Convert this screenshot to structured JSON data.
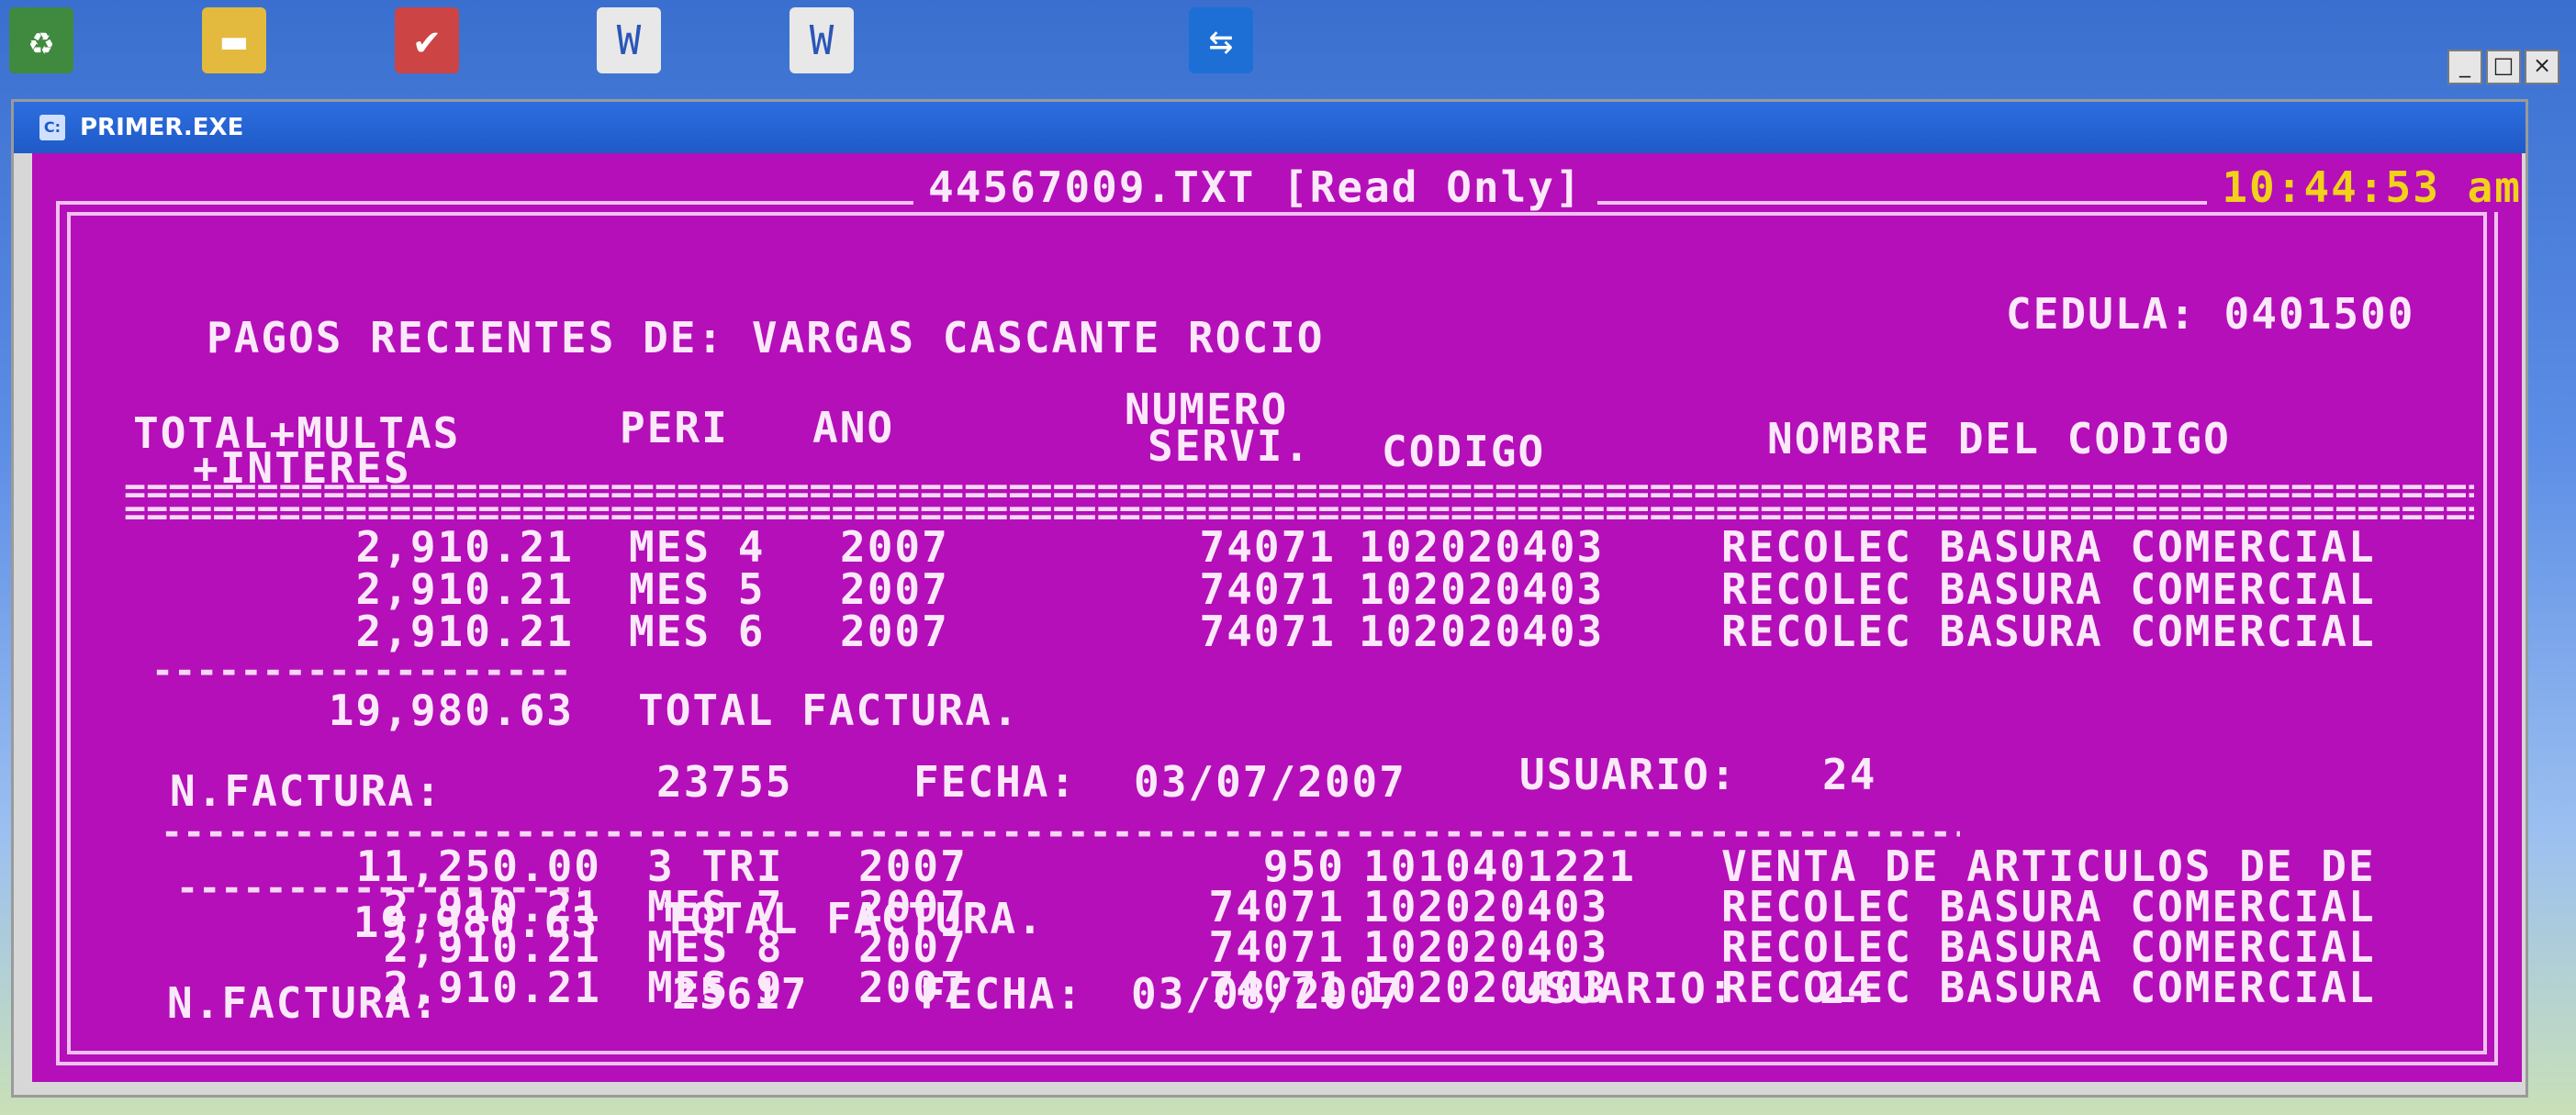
{
  "window": {
    "title": "PRIMER.EXE",
    "minimize": "_",
    "maximize": "□",
    "close": "×"
  },
  "screen": {
    "file_title": "44567009.TXT [Read Only]",
    "clock": "10:44:53 am",
    "heading": "PAGOS RECIENTES DE: VARGAS CASCANTE ROCIO",
    "cedula": "CEDULA: 0401500",
    "columns": {
      "total_line1": "TOTAL+MULTAS",
      "total_line2": "+INTERES",
      "peri": "PERI",
      "ano": "ANO",
      "numero_line1": "NUMERO",
      "numero_line2": "SERVI.",
      "codigo": "CODIGO",
      "nombre": "NOMBRE DEL CODIGO"
    },
    "invoices": [
      {
        "rows": [
          {
            "total": "2,910.21",
            "peri": "MES 4",
            "ano": "2007",
            "servi": "74071",
            "codigo": "102020403",
            "nombre": "RECOLEC BASURA COMERCIAL"
          },
          {
            "total": "2,910.21",
            "peri": "MES 5",
            "ano": "2007",
            "servi": "74071",
            "codigo": "102020403",
            "nombre": "RECOLEC BASURA COMERCIAL"
          },
          {
            "total": "2,910.21",
            "peri": "MES 6",
            "ano": "2007",
            "servi": "74071",
            "codigo": "102020403",
            "nombre": "RECOLEC BASURA COMERCIAL"
          }
        ],
        "total_amount": "19,980.63",
        "total_label": "TOTAL FACTURA.",
        "factura_label": "N.FACTURA:",
        "factura": "23755",
        "fecha_label": "FECHA:",
        "fecha": "03/07/2007",
        "usuario_label": "USUARIO:",
        "usuario": "24"
      },
      {
        "rows": [
          {
            "total": "11,250.00",
            "peri": "3 TRI",
            "ano": "2007",
            "servi": "950",
            "codigo": "1010401221",
            "nombre": "VENTA DE ARTICULOS DE DE"
          },
          {
            "total": "2,910.21",
            "peri": "MES 7",
            "ano": "2007",
            "servi": "74071",
            "codigo": "102020403",
            "nombre": "RECOLEC BASURA COMERCIAL"
          },
          {
            "total": "2,910.21",
            "peri": "MES 8",
            "ano": "2007",
            "servi": "74071",
            "codigo": "102020403",
            "nombre": "RECOLEC BASURA COMERCIAL"
          },
          {
            "total": "2,910.21",
            "peri": "MES 9",
            "ano": "2007",
            "servi": "74071",
            "codigo": "102020403",
            "nombre": "RECOLEC BASURA COMERCIAL"
          }
        ],
        "total_amount": "19,980.63",
        "total_label": "TOTAL FACTURA.",
        "factura_label": "N.FACTURA:",
        "factura": "25617",
        "fecha_label": "FECHA:",
        "fecha": "03/08/2007",
        "usuario_label": "USUARIO:",
        "usuario": "24"
      }
    ]
  },
  "colors": {
    "console_bg": "#b40fb8",
    "text": "#fbe9fb",
    "clock": "#f2d11a",
    "titlebar": "#1f5ac7"
  },
  "desktop_icons": [
    "recycle-bin-icon",
    "folder-icon",
    "app-icon",
    "word-doc-icon",
    "word-doc-icon",
    "teamviewer-icon"
  ]
}
